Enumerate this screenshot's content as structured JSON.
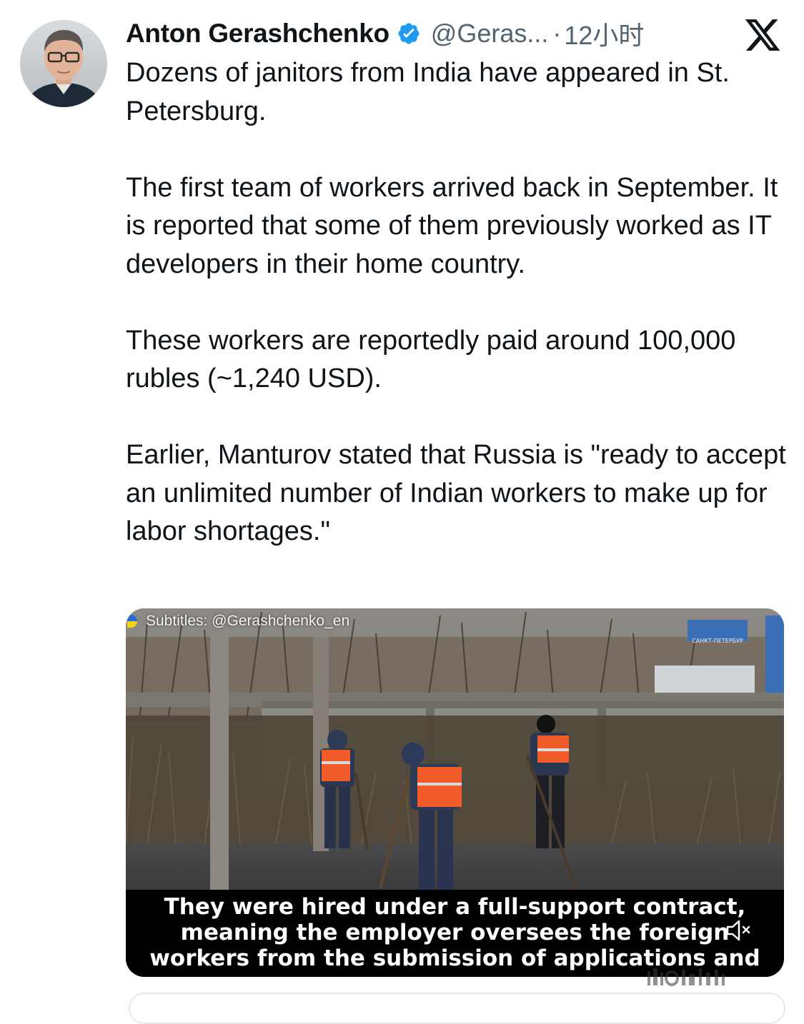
{
  "author": {
    "name": "Anton Gerashchenko",
    "handle": "@Geras...",
    "separator": "·",
    "time": "12小时"
  },
  "tweet": {
    "paragraphs": [
      "Dozens of janitors from India have appeared in St. Petersburg.",
      "The first team of workers arrived back in September. It is reported that some of them previously worked as IT developers in their home country.",
      "These workers are reportedly paid around 100,000 rubles (~1,240 USD).",
      "Earlier, Manturov stated that Russia is \"ready to accept an unlimited number of Indian workers to make up for labor shortages.\""
    ]
  },
  "media": {
    "credit": "Subtitles: @Gerashchenko_en",
    "sign_text": "САНКТ-ПЕТЕРБУР",
    "subtitle_lines": [
      "They were hired under a full-support contract,",
      "meaning the employer oversees the foreign",
      "workers from the submission of applications and"
    ]
  },
  "icons": {
    "verified": "verified-badge-icon",
    "platform": "x-logo-icon",
    "mute": "volume-muted-icon"
  },
  "colors": {
    "text": "#0f1419",
    "secondary": "#536471",
    "verified": "#1d9bf0",
    "vest": "#f25c2a"
  }
}
